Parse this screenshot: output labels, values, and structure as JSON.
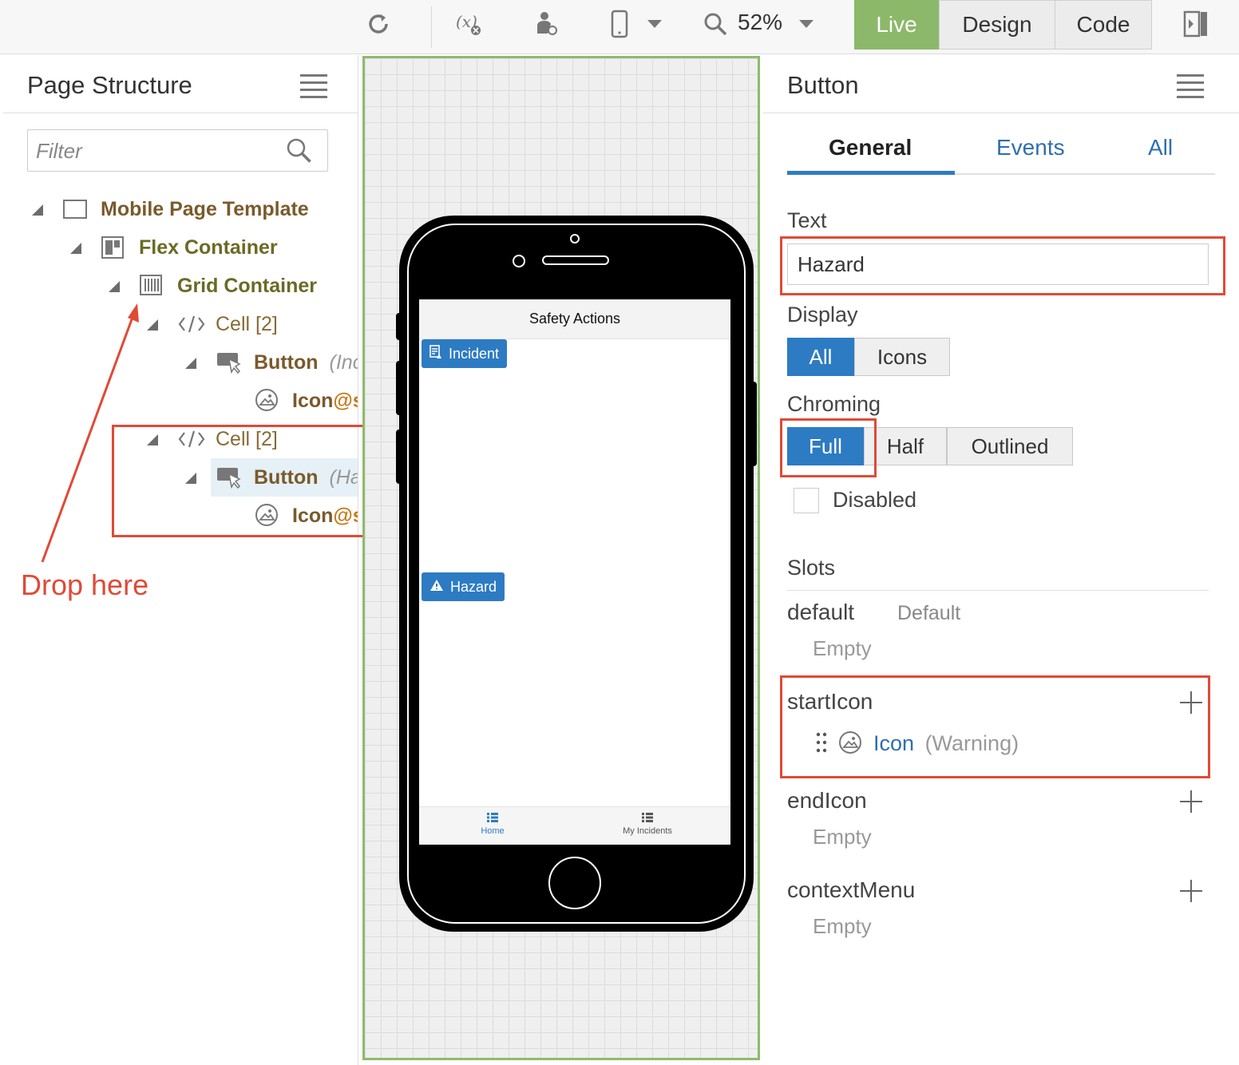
{
  "toolbar": {
    "icons": [
      "refresh-icon",
      "variables-icon",
      "user-roles-icon",
      "mobile-device-icon",
      "chevron-down-icon",
      "search-zoom-icon",
      "chevron-down-icon",
      "panel-toggle-icon"
    ],
    "zoom": "52%",
    "modes": {
      "live": "Live",
      "design": "Design",
      "code": "Code"
    },
    "live_color": "#8cb86a"
  },
  "structure": {
    "title": "Page Structure",
    "filter_placeholder": "Filter",
    "tree": {
      "mobile_page_template": "Mobile Page Template",
      "flex_container": "Flex Container",
      "grid_container": "Grid Container",
      "cell1": "Cell [2]",
      "button1": "Button",
      "button1_sub": "(Inc",
      "icon1": "Icon",
      "icon1_suffix": "@s",
      "cell2": "Cell [2]",
      "button2": "Button",
      "button2_sub": "(Ha",
      "icon2": "Icon",
      "icon2_suffix": "@s"
    },
    "annotation": "Drop here",
    "annotation_color": "#e04a37"
  },
  "canvas": {
    "screen_title": "Safety Actions",
    "buttons": {
      "incident": "Incident",
      "hazard": "Hazard"
    },
    "nav": {
      "home": "Home",
      "my_incidents": "My Incidents"
    },
    "accent_color": "#2d7bc3"
  },
  "properties": {
    "title": "Button",
    "tabs": {
      "general": "General",
      "events": "Events",
      "all": "All"
    },
    "text_label": "Text",
    "text_value": "Hazard",
    "display_label": "Display",
    "display_options": {
      "all": "All",
      "icons": "Icons"
    },
    "display_selected": "All",
    "chroming_label": "Chroming",
    "chroming_options": {
      "full": "Full",
      "half": "Half",
      "outlined": "Outlined"
    },
    "chroming_selected": "Full",
    "disabled_label": "Disabled",
    "disabled_checked": false,
    "slots_label": "Slots",
    "slots": {
      "default": {
        "name": "default",
        "hint": "Default",
        "value": "Empty"
      },
      "start_icon": {
        "name": "startIcon",
        "item": "Icon",
        "item_sub": "(Warning)"
      },
      "end_icon": {
        "name": "endIcon",
        "value": "Empty"
      },
      "context_menu": {
        "name": "contextMenu",
        "value": "Empty"
      }
    }
  }
}
